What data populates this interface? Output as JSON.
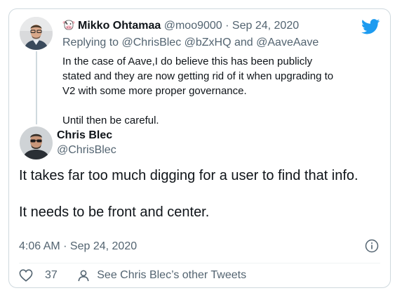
{
  "parent_tweet": {
    "author_name": "Mikko Ohtamaa",
    "author_handle": "@moo9000",
    "separator": "·",
    "date": "Sep 24, 2020",
    "replying_to": "Replying to @ChrisBlec @bZxHQ and @AaveAave",
    "text_paragraphs": [
      "In the case of Aave,I do believe this has been publicly stated and they are now getting rid of it when upgrading to V2 with some more proper governance.",
      "Until then be careful."
    ]
  },
  "main_tweet": {
    "author_name": "Chris Blec",
    "author_handle": "@ChrisBlec",
    "text_paragraphs": [
      "It takes far too much digging for a user to find that info.",
      "It needs to be front and center."
    ],
    "timestamp": "4:06 AM · Sep 24, 2020"
  },
  "actions": {
    "like_count": "37",
    "other_tweets_label": "See Chris Blec’s other Tweets"
  },
  "colors": {
    "twitter_blue": "#1d9bf0",
    "secondary_text": "#536471",
    "border": "#cfd9de"
  },
  "icons": [
    "twitter-logo-icon",
    "cow-emoji-icon",
    "info-icon",
    "heart-icon",
    "profile-icon"
  ]
}
